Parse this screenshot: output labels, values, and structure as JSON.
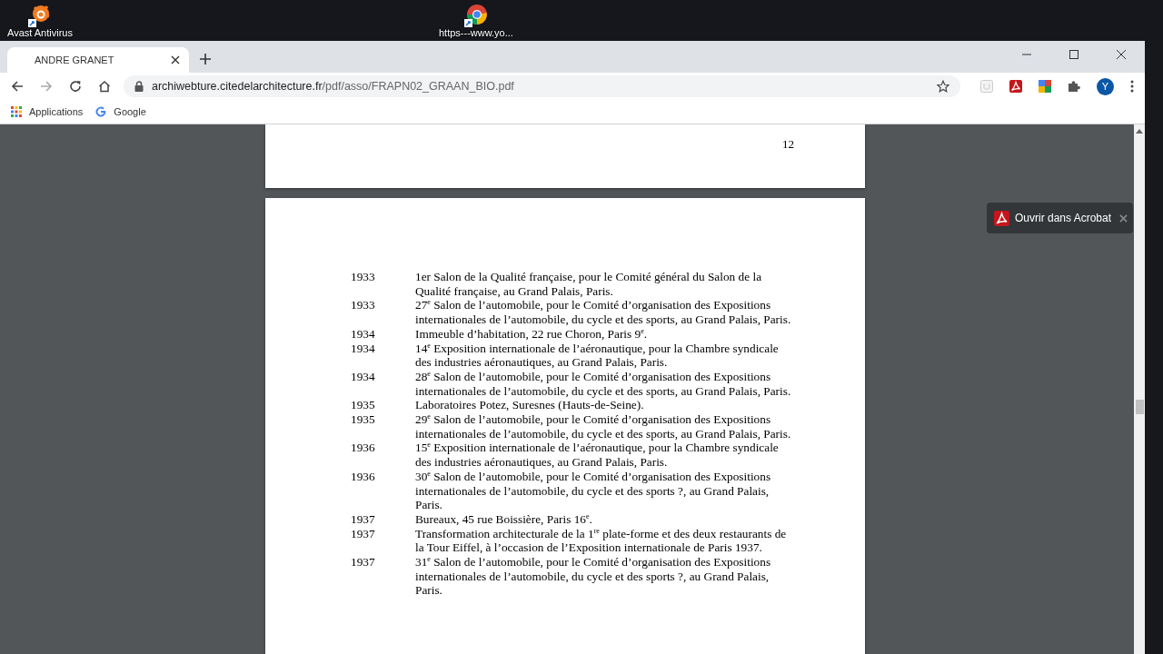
{
  "desktop_icons": [
    {
      "label": "Avast Antivirus",
      "kind": "avast"
    },
    {
      "label": "https---www.yo...",
      "kind": "chrome"
    }
  ],
  "tab": {
    "title": "ANDRE GRANET",
    "selected": true
  },
  "address": {
    "host": "archiwebture.citedelarchitecture.fr",
    "path": "/pdf/asso/FRAPN02_GRAAN_BIO.pdf"
  },
  "profile": "Y",
  "bookmarks": [
    {
      "label": "Applications",
      "kind": "apps"
    },
    {
      "label": "Google",
      "kind": "google"
    }
  ],
  "pdf": {
    "page_number": "12",
    "entries": [
      {
        "year": "1933",
        "text": "1er Salon de la Qualité française, pour le Comité général du Salon de la Qualité française, au Grand Palais, Paris."
      },
      {
        "year": "1933",
        "text": "27$^{e}$ Salon de l’automobile, pour le Comité d’organisation des Expositions internationales de l’automobile, du cycle et des sports, au Grand Palais, Paris."
      },
      {
        "year": "1934",
        "text": "Immeuble d’habitation, 22 rue Choron, Paris 9$^{e}$."
      },
      {
        "year": "1934",
        "text": "14$^{e}$ Exposition internationale de l’aéronautique, pour la Chambre syndicale des industries aéronautiques, au Grand Palais, Paris."
      },
      {
        "year": "1934",
        "text": "28$^{e}$ Salon de l’automobile, pour le Comité d’organisation des Expositions internationales de l’automobile, du cycle et des sports, au Grand Palais, Paris."
      },
      {
        "year": "1935",
        "text": "Laboratoires Potez, Suresnes (Hauts-de-Seine)."
      },
      {
        "year": "1935",
        "text": "29$^{e}$ Salon de l’automobile, pour le Comité d’organisation des Expositions internationales de l’automobile, du cycle et des sports, au Grand Palais, Paris."
      },
      {
        "year": "1936",
        "text": "15$^{e}$ Exposition internationale de l’aéronautique, pour la Chambre syndicale des industries aéronautiques, au Grand Palais, Paris."
      },
      {
        "year": "1936",
        "text": "30$^{e}$ Salon de l’automobile, pour le Comité d’organisation des Expositions internationales de l’automobile, du cycle et des sports ?, au Grand Palais, Paris."
      },
      {
        "year": "1937",
        "text": "Bureaux, 45 rue Boissière, Paris 16$^{e}$."
      },
      {
        "year": "1937",
        "text": "Transformation architecturale de la 1$^{re}$ plate-forme et des deux restaurants de la Tour Eiffel, à l’occasion de l’Exposition internationale de Paris 1937."
      },
      {
        "year": "1937",
        "text": "31$^{e}$ Salon de l’automobile, pour le Comité d’organisation des Expositions internationales de l’automobile, du cycle et des sports ?, au Grand Palais, Paris."
      }
    ]
  },
  "acrobat_popup": {
    "label": "Ouvrir dans Acrobat"
  }
}
